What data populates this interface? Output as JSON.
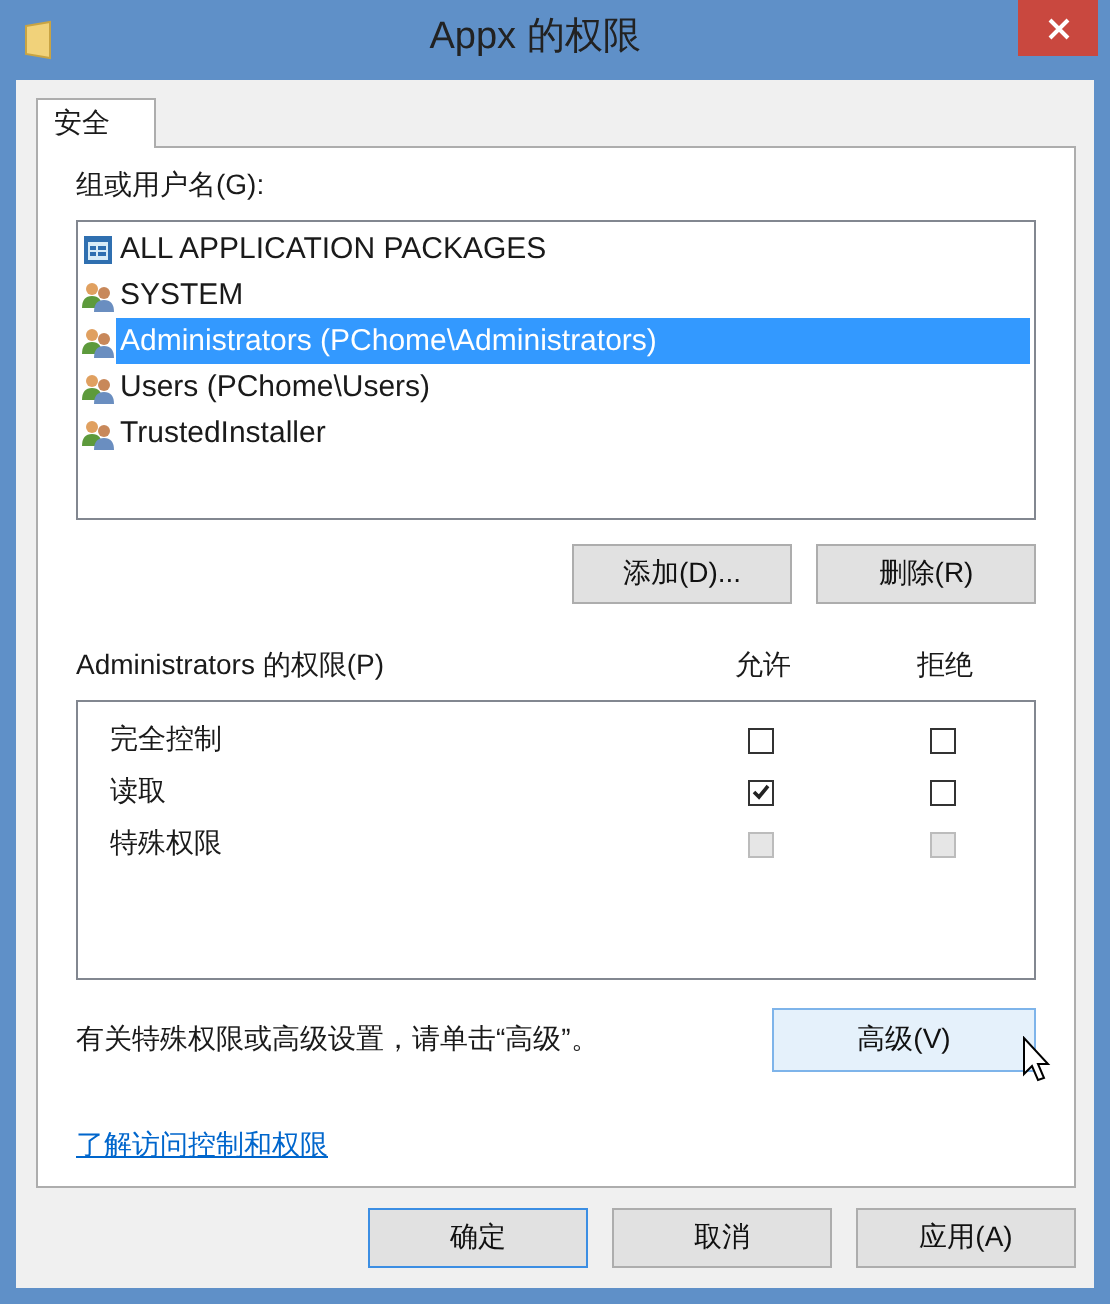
{
  "window": {
    "title": "Appx 的权限"
  },
  "tabs": [
    {
      "label": "安全",
      "selected": true
    }
  ],
  "groups": {
    "label": "组或用户名(G):",
    "items": [
      {
        "name": "ALL APPLICATION PACKAGES",
        "kind": "package",
        "selected": false
      },
      {
        "name": "SYSTEM",
        "kind": "group",
        "selected": false
      },
      {
        "name": "Administrators (PChome\\Administrators)",
        "kind": "group",
        "selected": true
      },
      {
        "name": "Users (PChome\\Users)",
        "kind": "group",
        "selected": false
      },
      {
        "name": "TrustedInstaller",
        "kind": "group",
        "selected": false
      }
    ],
    "buttons": [
      {
        "label": "添加(D)..."
      },
      {
        "label": "删除(R)"
      }
    ]
  },
  "permissions": {
    "label": "Administrators 的权限(P)",
    "columns": [
      "允许",
      "拒绝"
    ],
    "rows": [
      {
        "name": "完全控制",
        "allow": {
          "checked": false,
          "disabled": false
        },
        "deny": {
          "checked": false,
          "disabled": false
        }
      },
      {
        "name": "读取",
        "allow": {
          "checked": true,
          "disabled": false
        },
        "deny": {
          "checked": false,
          "disabled": false
        }
      },
      {
        "name": "特殊权限",
        "allow": {
          "checked": false,
          "disabled": true
        },
        "deny": {
          "checked": false,
          "disabled": true
        }
      }
    ]
  },
  "advanced": {
    "text": "有关特殊权限或高级设置，请单击“高级”。",
    "button": {
      "label": "高级(V)",
      "hovered": true
    }
  },
  "link": "了解访问控制和权限",
  "footer_buttons": [
    {
      "label": "确定",
      "default": true
    },
    {
      "label": "取消",
      "default": false
    },
    {
      "label": "应用(A)",
      "default": false
    }
  ]
}
